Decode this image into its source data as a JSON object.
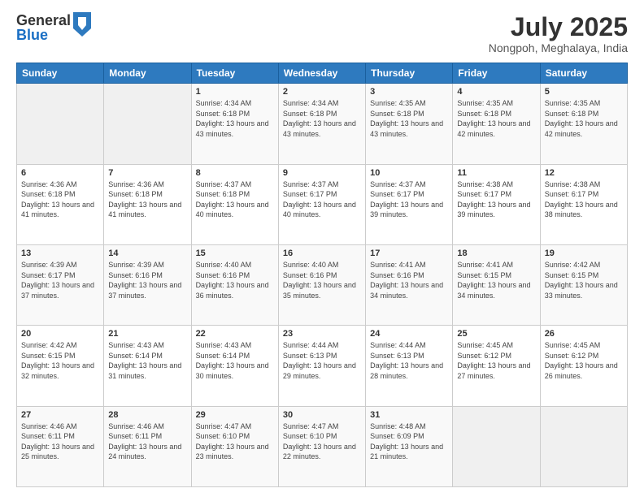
{
  "header": {
    "logo_general": "General",
    "logo_blue": "Blue",
    "month": "July 2025",
    "location": "Nongpoh, Meghalaya, India"
  },
  "days_of_week": [
    "Sunday",
    "Monday",
    "Tuesday",
    "Wednesday",
    "Thursday",
    "Friday",
    "Saturday"
  ],
  "weeks": [
    [
      {
        "day": "",
        "info": ""
      },
      {
        "day": "",
        "info": ""
      },
      {
        "day": "1",
        "info": "Sunrise: 4:34 AM\nSunset: 6:18 PM\nDaylight: 13 hours and 43 minutes."
      },
      {
        "day": "2",
        "info": "Sunrise: 4:34 AM\nSunset: 6:18 PM\nDaylight: 13 hours and 43 minutes."
      },
      {
        "day": "3",
        "info": "Sunrise: 4:35 AM\nSunset: 6:18 PM\nDaylight: 13 hours and 43 minutes."
      },
      {
        "day": "4",
        "info": "Sunrise: 4:35 AM\nSunset: 6:18 PM\nDaylight: 13 hours and 42 minutes."
      },
      {
        "day": "5",
        "info": "Sunrise: 4:35 AM\nSunset: 6:18 PM\nDaylight: 13 hours and 42 minutes."
      }
    ],
    [
      {
        "day": "6",
        "info": "Sunrise: 4:36 AM\nSunset: 6:18 PM\nDaylight: 13 hours and 41 minutes."
      },
      {
        "day": "7",
        "info": "Sunrise: 4:36 AM\nSunset: 6:18 PM\nDaylight: 13 hours and 41 minutes."
      },
      {
        "day": "8",
        "info": "Sunrise: 4:37 AM\nSunset: 6:18 PM\nDaylight: 13 hours and 40 minutes."
      },
      {
        "day": "9",
        "info": "Sunrise: 4:37 AM\nSunset: 6:17 PM\nDaylight: 13 hours and 40 minutes."
      },
      {
        "day": "10",
        "info": "Sunrise: 4:37 AM\nSunset: 6:17 PM\nDaylight: 13 hours and 39 minutes."
      },
      {
        "day": "11",
        "info": "Sunrise: 4:38 AM\nSunset: 6:17 PM\nDaylight: 13 hours and 39 minutes."
      },
      {
        "day": "12",
        "info": "Sunrise: 4:38 AM\nSunset: 6:17 PM\nDaylight: 13 hours and 38 minutes."
      }
    ],
    [
      {
        "day": "13",
        "info": "Sunrise: 4:39 AM\nSunset: 6:17 PM\nDaylight: 13 hours and 37 minutes."
      },
      {
        "day": "14",
        "info": "Sunrise: 4:39 AM\nSunset: 6:16 PM\nDaylight: 13 hours and 37 minutes."
      },
      {
        "day": "15",
        "info": "Sunrise: 4:40 AM\nSunset: 6:16 PM\nDaylight: 13 hours and 36 minutes."
      },
      {
        "day": "16",
        "info": "Sunrise: 4:40 AM\nSunset: 6:16 PM\nDaylight: 13 hours and 35 minutes."
      },
      {
        "day": "17",
        "info": "Sunrise: 4:41 AM\nSunset: 6:16 PM\nDaylight: 13 hours and 34 minutes."
      },
      {
        "day": "18",
        "info": "Sunrise: 4:41 AM\nSunset: 6:15 PM\nDaylight: 13 hours and 34 minutes."
      },
      {
        "day": "19",
        "info": "Sunrise: 4:42 AM\nSunset: 6:15 PM\nDaylight: 13 hours and 33 minutes."
      }
    ],
    [
      {
        "day": "20",
        "info": "Sunrise: 4:42 AM\nSunset: 6:15 PM\nDaylight: 13 hours and 32 minutes."
      },
      {
        "day": "21",
        "info": "Sunrise: 4:43 AM\nSunset: 6:14 PM\nDaylight: 13 hours and 31 minutes."
      },
      {
        "day": "22",
        "info": "Sunrise: 4:43 AM\nSunset: 6:14 PM\nDaylight: 13 hours and 30 minutes."
      },
      {
        "day": "23",
        "info": "Sunrise: 4:44 AM\nSunset: 6:13 PM\nDaylight: 13 hours and 29 minutes."
      },
      {
        "day": "24",
        "info": "Sunrise: 4:44 AM\nSunset: 6:13 PM\nDaylight: 13 hours and 28 minutes."
      },
      {
        "day": "25",
        "info": "Sunrise: 4:45 AM\nSunset: 6:12 PM\nDaylight: 13 hours and 27 minutes."
      },
      {
        "day": "26",
        "info": "Sunrise: 4:45 AM\nSunset: 6:12 PM\nDaylight: 13 hours and 26 minutes."
      }
    ],
    [
      {
        "day": "27",
        "info": "Sunrise: 4:46 AM\nSunset: 6:11 PM\nDaylight: 13 hours and 25 minutes."
      },
      {
        "day": "28",
        "info": "Sunrise: 4:46 AM\nSunset: 6:11 PM\nDaylight: 13 hours and 24 minutes."
      },
      {
        "day": "29",
        "info": "Sunrise: 4:47 AM\nSunset: 6:10 PM\nDaylight: 13 hours and 23 minutes."
      },
      {
        "day": "30",
        "info": "Sunrise: 4:47 AM\nSunset: 6:10 PM\nDaylight: 13 hours and 22 minutes."
      },
      {
        "day": "31",
        "info": "Sunrise: 4:48 AM\nSunset: 6:09 PM\nDaylight: 13 hours and 21 minutes."
      },
      {
        "day": "",
        "info": ""
      },
      {
        "day": "",
        "info": ""
      }
    ]
  ]
}
